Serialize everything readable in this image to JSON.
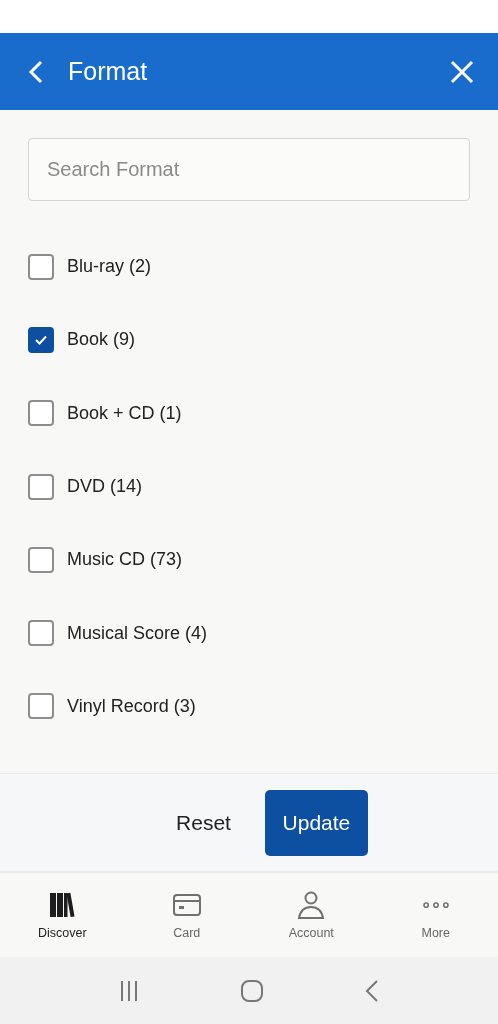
{
  "header": {
    "title": "Format"
  },
  "search": {
    "placeholder": "Search Format"
  },
  "options": [
    {
      "label": "Blu-ray (2)",
      "checked": false
    },
    {
      "label": "Book (9)",
      "checked": true
    },
    {
      "label": "Book + CD (1)",
      "checked": false
    },
    {
      "label": "DVD (14)",
      "checked": false
    },
    {
      "label": "Music CD (73)",
      "checked": false
    },
    {
      "label": "Musical Score (4)",
      "checked": false
    },
    {
      "label": "Vinyl Record (3)",
      "checked": false
    }
  ],
  "actions": {
    "reset": "Reset",
    "update": "Update"
  },
  "bottom_nav": [
    {
      "kind": "discover",
      "label": "Discover",
      "selected": true
    },
    {
      "kind": "card",
      "label": "Card",
      "selected": false
    },
    {
      "kind": "account",
      "label": "Account",
      "selected": false
    },
    {
      "kind": "more",
      "label": "More",
      "selected": false
    }
  ]
}
